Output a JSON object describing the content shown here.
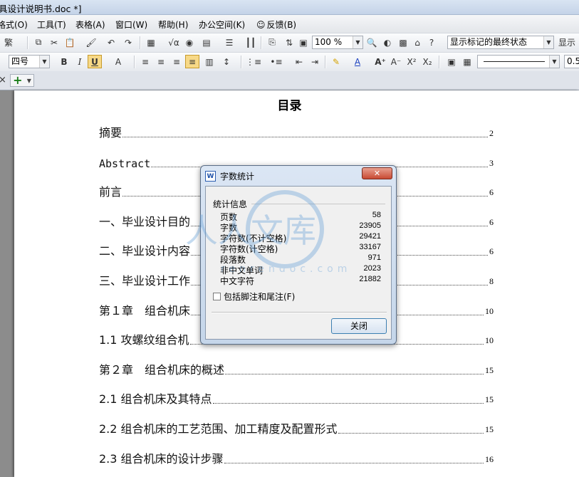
{
  "window": {
    "title": "具设计说明书.doc *]"
  },
  "menu": {
    "items": [
      {
        "id": "format",
        "label": "格式(O)"
      },
      {
        "id": "tools",
        "label": "工具(T)"
      },
      {
        "id": "table",
        "label": "表格(A)"
      },
      {
        "id": "window",
        "label": "窗口(W)"
      },
      {
        "id": "help",
        "label": "帮助(H)"
      },
      {
        "id": "office",
        "label": "办公空间(K)"
      },
      {
        "id": "feedback",
        "label": "反馈(B)"
      }
    ]
  },
  "toolbar1": {
    "fan_label": "繁",
    "zoom_value": "100 %",
    "track_mode_value": "显示标记的最终状态",
    "show_label": "显示"
  },
  "toolbar2": {
    "font_size_value": "四号",
    "bold": "B",
    "italic": "I",
    "underline": "U",
    "line_value": "0.5"
  },
  "document": {
    "title": "目录",
    "toc": [
      {
        "text": "摘要",
        "page": "2"
      },
      {
        "text": "Abstract",
        "page": "3"
      },
      {
        "text": "前言",
        "page": "6"
      },
      {
        "text": "一、毕业设计目的",
        "page": "6"
      },
      {
        "text": "二、毕业设计内容",
        "page": "6"
      },
      {
        "text": "三、毕业设计工作",
        "page": "8"
      },
      {
        "text": "第１章　组合机床",
        "page": "10"
      },
      {
        "text": "1.1 攻螺纹组合机",
        "page": "10"
      },
      {
        "text": "第２章　组合机床的概述",
        "page": "15"
      },
      {
        "text": "2.1 组合机床及其特点",
        "page": "15"
      },
      {
        "text": "2.2 组合机床的工艺范围、加工精度及配置形式",
        "page": "15"
      },
      {
        "text": "2.3 组合机床的设计步骤",
        "page": "16"
      }
    ]
  },
  "dialog": {
    "title": "字数统计",
    "group_label": "统计信息",
    "stats": [
      {
        "label": "页数",
        "value": "58"
      },
      {
        "label": "字数",
        "value": "23905"
      },
      {
        "label": "字符数(不计空格)",
        "value": "29421"
      },
      {
        "label": "字符数(计空格)",
        "value": "33167"
      },
      {
        "label": "段落数",
        "value": "971"
      },
      {
        "label": "非中文单词",
        "value": "2023"
      },
      {
        "label": "中文字符",
        "value": "21882"
      }
    ],
    "checkbox_label": "包括脚注和尾注(F)",
    "close_button": "关闭"
  },
  "watermark": {
    "text": "人人文库",
    "url": "renrendoc.com"
  }
}
